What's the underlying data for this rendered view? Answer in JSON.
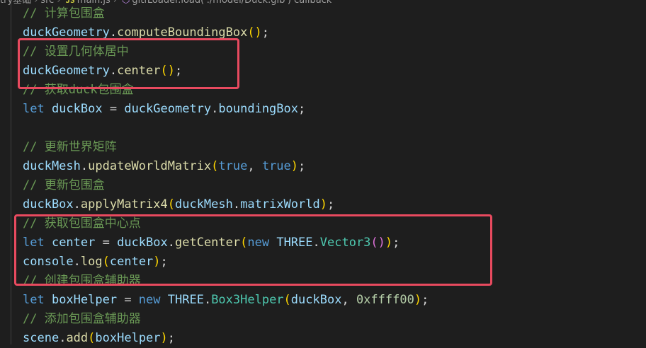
{
  "breadcrumb": {
    "project": "try基础",
    "folder": "src",
    "file": "main.js",
    "file_icon": "JS",
    "symbol": "gltfLoader.load('./model/Duck.glb') callback",
    "separator": "›"
  },
  "editor": {
    "highlight_color": "#e84a5f",
    "lines": [
      [
        {
          "t": "// 计算包围盒",
          "c": "comment"
        }
      ],
      [
        {
          "t": "duckGeometry",
          "c": "ident"
        },
        {
          "t": ".",
          "c": "punc"
        },
        {
          "t": "computeBoundingBox",
          "c": "fn"
        },
        {
          "t": "()",
          "c": "paren1"
        },
        {
          "t": ";",
          "c": "punc"
        }
      ],
      [
        {
          "t": "// 设置几何体居中",
          "c": "comment"
        }
      ],
      [
        {
          "t": "duckGeometry",
          "c": "ident"
        },
        {
          "t": ".",
          "c": "punc"
        },
        {
          "t": "center",
          "c": "fn"
        },
        {
          "t": "()",
          "c": "paren1"
        },
        {
          "t": ";",
          "c": "punc"
        }
      ],
      [
        {
          "t": "// 获取duck包围盒",
          "c": "comment"
        }
      ],
      [
        {
          "t": "let ",
          "c": "keyword"
        },
        {
          "t": "duckBox",
          "c": "ident"
        },
        {
          "t": " = ",
          "c": "punc"
        },
        {
          "t": "duckGeometry",
          "c": "ident"
        },
        {
          "t": ".",
          "c": "punc"
        },
        {
          "t": "boundingBox",
          "c": "ident"
        },
        {
          "t": ";",
          "c": "punc"
        }
      ],
      [],
      [
        {
          "t": "// 更新世界矩阵",
          "c": "comment"
        }
      ],
      [
        {
          "t": "duckMesh",
          "c": "ident"
        },
        {
          "t": ".",
          "c": "punc"
        },
        {
          "t": "updateWorldMatrix",
          "c": "fn"
        },
        {
          "t": "(",
          "c": "paren1"
        },
        {
          "t": "true",
          "c": "keyword"
        },
        {
          "t": ", ",
          "c": "punc"
        },
        {
          "t": "true",
          "c": "keyword"
        },
        {
          "t": ")",
          "c": "paren1"
        },
        {
          "t": ";",
          "c": "punc"
        }
      ],
      [
        {
          "t": "// 更新包围盒",
          "c": "comment"
        }
      ],
      [
        {
          "t": "duckBox",
          "c": "ident"
        },
        {
          "t": ".",
          "c": "punc"
        },
        {
          "t": "applyMatrix4",
          "c": "fn"
        },
        {
          "t": "(",
          "c": "paren1"
        },
        {
          "t": "duckMesh",
          "c": "ident"
        },
        {
          "t": ".",
          "c": "punc"
        },
        {
          "t": "matrixWorld",
          "c": "ident"
        },
        {
          "t": ")",
          "c": "paren1"
        },
        {
          "t": ";",
          "c": "punc"
        }
      ],
      [
        {
          "t": "// 获取包围盒中心点",
          "c": "comment"
        }
      ],
      [
        {
          "t": "let ",
          "c": "keyword"
        },
        {
          "t": "center",
          "c": "ident"
        },
        {
          "t": " = ",
          "c": "punc"
        },
        {
          "t": "duckBox",
          "c": "ident"
        },
        {
          "t": ".",
          "c": "punc"
        },
        {
          "t": "getCenter",
          "c": "fn"
        },
        {
          "t": "(",
          "c": "paren1"
        },
        {
          "t": "new ",
          "c": "keyword"
        },
        {
          "t": "THREE",
          "c": "ident"
        },
        {
          "t": ".",
          "c": "punc"
        },
        {
          "t": "Vector3",
          "c": "class"
        },
        {
          "t": "()",
          "c": "paren2"
        },
        {
          "t": ")",
          "c": "paren1"
        },
        {
          "t": ";",
          "c": "punc"
        }
      ],
      [
        {
          "t": "console",
          "c": "ident"
        },
        {
          "t": ".",
          "c": "punc"
        },
        {
          "t": "log",
          "c": "fn"
        },
        {
          "t": "(",
          "c": "paren1"
        },
        {
          "t": "center",
          "c": "ident"
        },
        {
          "t": ")",
          "c": "paren1"
        },
        {
          "t": ";",
          "c": "punc"
        }
      ],
      [
        {
          "t": "// 创建包围盒辅助器",
          "c": "comment"
        }
      ],
      [
        {
          "t": "let ",
          "c": "keyword"
        },
        {
          "t": "boxHelper",
          "c": "ident"
        },
        {
          "t": " = ",
          "c": "punc"
        },
        {
          "t": "new ",
          "c": "keyword"
        },
        {
          "t": "THREE",
          "c": "ident"
        },
        {
          "t": ".",
          "c": "punc"
        },
        {
          "t": "Box3Helper",
          "c": "class"
        },
        {
          "t": "(",
          "c": "paren1"
        },
        {
          "t": "duckBox",
          "c": "ident"
        },
        {
          "t": ", ",
          "c": "punc"
        },
        {
          "t": "0xffff00",
          "c": "num"
        },
        {
          "t": ")",
          "c": "paren1"
        },
        {
          "t": ";",
          "c": "punc"
        }
      ],
      [
        {
          "t": "// 添加包围盒辅助器",
          "c": "comment"
        }
      ],
      [
        {
          "t": "scene",
          "c": "ident"
        },
        {
          "t": ".",
          "c": "punc"
        },
        {
          "t": "add",
          "c": "fn"
        },
        {
          "t": "(",
          "c": "paren1"
        },
        {
          "t": "boxHelper",
          "c": "ident"
        },
        {
          "t": ")",
          "c": "paren1"
        },
        {
          "t": ";",
          "c": "punc"
        }
      ]
    ]
  }
}
